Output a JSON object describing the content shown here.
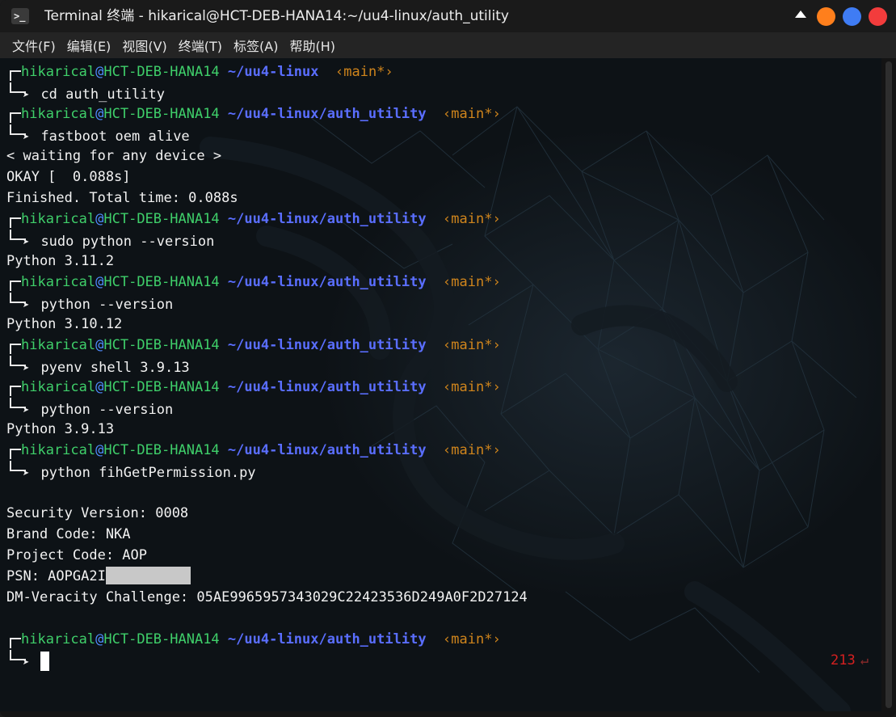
{
  "window": {
    "title": "Terminal 终端 - hikarical@HCT-DEB-HANA14:~/uu4-linux/auth_utility",
    "app_icon_glyph": ">_",
    "controls": {
      "collapse_color": "#ffffff",
      "minimize_color": "#ff7f1c",
      "maximize_color": "#3f7cf4",
      "close_color": "#f23c3c"
    }
  },
  "menubar": {
    "items": [
      "文件(F)",
      "编辑(E)",
      "视图(V)",
      "终端(T)",
      "标签(A)",
      "帮助(H)"
    ]
  },
  "prompt": {
    "user": "hikarical",
    "at": "@",
    "host": "HCT-DEB-HANA14",
    "arrow": "➤"
  },
  "session": [
    {
      "path": "~/uu4-linux",
      "branch": "‹main*›",
      "command": "cd auth_utility",
      "output": []
    },
    {
      "path": "~/uu4-linux/auth_utility",
      "branch": "‹main*›",
      "command": "fastboot oem alive",
      "output": [
        "< waiting for any device >",
        "OKAY [  0.088s]",
        "Finished. Total time: 0.088s"
      ]
    },
    {
      "path": "~/uu4-linux/auth_utility",
      "branch": "‹main*›",
      "command": "sudo python --version",
      "output": [
        "Python 3.11.2"
      ]
    },
    {
      "path": "~/uu4-linux/auth_utility",
      "branch": "‹main*›",
      "command": "python --version",
      "output": [
        "Python 3.10.12"
      ]
    },
    {
      "path": "~/uu4-linux/auth_utility",
      "branch": "‹main*›",
      "command": "pyenv shell 3.9.13",
      "output": []
    },
    {
      "path": "~/uu4-linux/auth_utility",
      "branch": "‹main*›",
      "command": "python --version",
      "output": [
        "Python 3.9.13"
      ]
    },
    {
      "path": "~/uu4-linux/auth_utility",
      "branch": "‹main*›",
      "command": "python fihGetPermission.py",
      "output": [
        "",
        "Security Version: 0008",
        "Brand Code: NKA",
        "Project Code: AOP",
        "PSN: AOPGA2I",
        "DM-Veracity Challenge: 05AE9965957343029C22423536D249A0F2D27124",
        ""
      ]
    }
  ],
  "final_prompt": {
    "path": "~/uu4-linux/auth_utility",
    "branch": "‹main*›",
    "right_status": "213",
    "right_status_icon": "↵"
  }
}
